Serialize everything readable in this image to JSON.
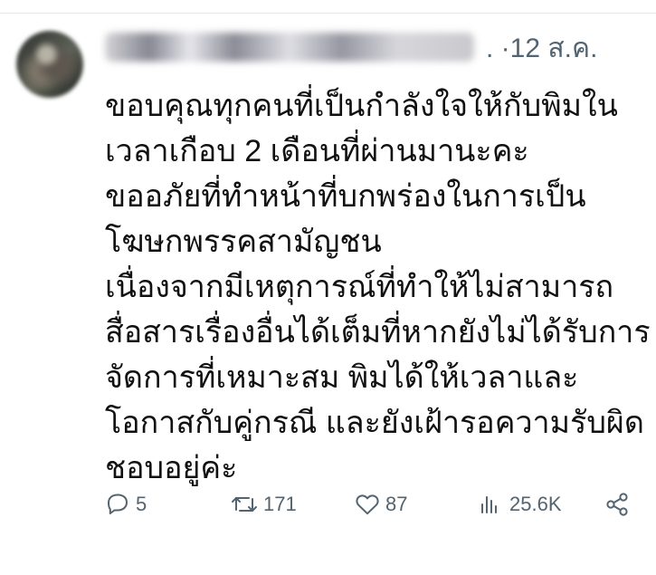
{
  "post": {
    "time": ". ·12 ส.ค.",
    "text_lines": [
      "ขอบคุณทุกคนที่เป็นกำลังใจให้กับพิมใน",
      "เวลาเกือบ 2 เดือนที่ผ่านมานะคะ",
      "ขออภัยที่ทำหน้าที่บกพร่องในการเป็น",
      "โฆษกพรรคสามัญชน",
      "เนื่องจากมีเหตุการณ์ที่ทำให้ไม่สามารถ",
      "สื่อสารเรื่องอื่นได้เต็มที่หากยังไม่ได้รับการ",
      "จัดการที่เหมาะสม พิมได้ให้เวลาและ",
      "โอกาสกับคู่กรณี และยังเฝ้ารอความรับผิด",
      "ชอบอยู่ค่ะ"
    ]
  },
  "metrics": {
    "replies": "5",
    "reposts": "171",
    "likes": "87",
    "views": "25.6K"
  },
  "icons": {
    "reply": "reply-icon",
    "repost": "repost-icon",
    "like": "heart-icon",
    "views": "views-icon",
    "share": "share-icon"
  },
  "colors": {
    "text": "#111111",
    "secondary": "#536471",
    "divider": "#e6e9ec"
  }
}
